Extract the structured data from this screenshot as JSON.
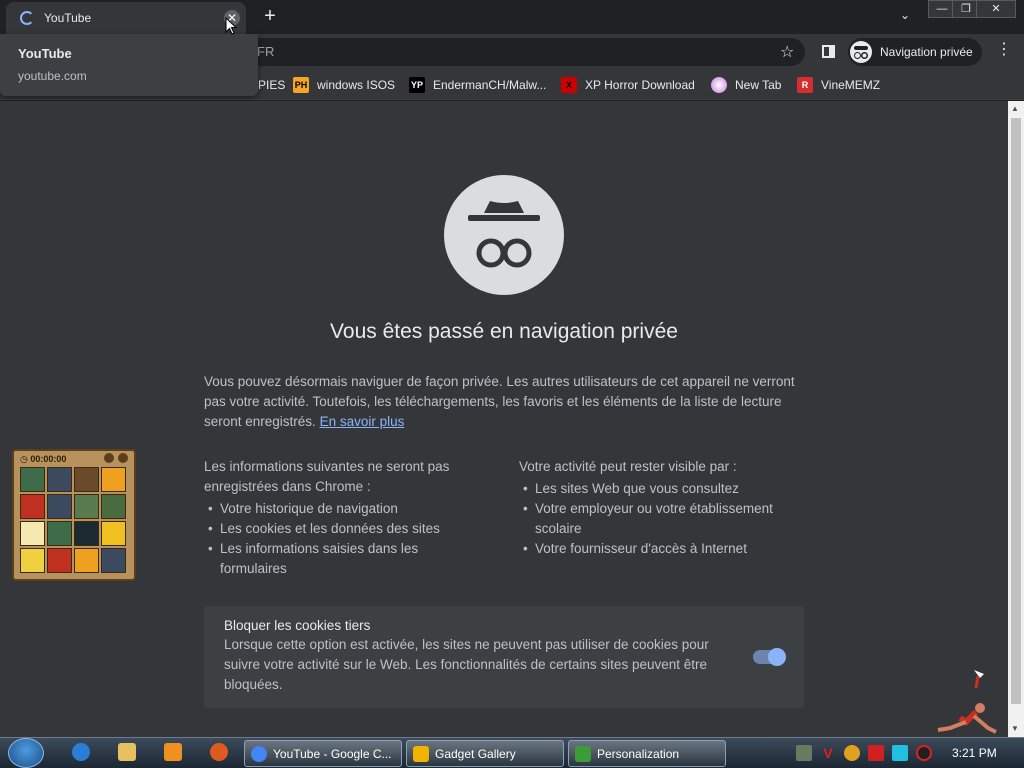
{
  "tab": {
    "title": "YouTube",
    "close_glyph": "✕"
  },
  "newtab_glyph": "+",
  "tabsearch_glyph": "⌄",
  "window_controls": {
    "minimize": "—",
    "restore": "❐",
    "close": "✕"
  },
  "omnibox": {
    "text": "FR"
  },
  "toolbar": {
    "star_glyph": "☆",
    "incognito_label": "Navigation privée",
    "menu_glyph": "⋮"
  },
  "hover_card": {
    "title": "YouTube",
    "url": "youtube.com"
  },
  "bookmarks": [
    {
      "label": "PIES",
      "icon": "bookmark-icon",
      "color": "#35363a"
    },
    {
      "label": "windows ISOS",
      "icon": "ph-icon",
      "badge": "PH",
      "color": "#f5a623"
    },
    {
      "label": "EndermanCH/Malw...",
      "icon": "yp-icon",
      "badge": "YP",
      "color": "#202124"
    },
    {
      "label": "XP Horror Download",
      "icon": "x-icon",
      "badge": "X",
      "color": "#cc0000"
    },
    {
      "label": "New Tab",
      "icon": "globe-icon",
      "badge": "",
      "color": "#c678dd"
    },
    {
      "label": "VineMEMZ",
      "icon": "r-icon",
      "badge": "R",
      "color": "#d32f2f"
    }
  ],
  "content": {
    "heading": "Vous êtes passé en navigation privée",
    "intro": "Vous pouvez désormais naviguer de façon privée. Les autres utilisateurs de cet appareil ne verront pas votre activité. Toutefois, les téléchargements, les favoris et les éléments de la liste de lecture seront enregistrés.",
    "learn_more": "En savoir plus",
    "left_title": "Les informations suivantes ne seront pas enregistrées dans Chrome :",
    "left_items": [
      "Votre historique de navigation",
      "Les cookies et les données des sites",
      "Les informations saisies dans les formulaires"
    ],
    "right_title": "Votre activité peut rester visible par :",
    "right_items": [
      "Les sites Web que vous consultez",
      "Votre employeur ou votre établissement scolaire",
      "Votre fournisseur d'accès à Internet"
    ],
    "cookie_title": "Bloquer les cookies tiers",
    "cookie_desc": "Lorsque cette option est activée, les sites ne peuvent pas utiliser de cookies pour suivre votre activité sur le Web. Les fonctionnalités de certains sites peuvent être bloquées.",
    "cookie_toggle_on": true
  },
  "puzzle_gadget": {
    "timer": "00:00:00"
  },
  "taskbar": {
    "buttons": [
      {
        "label": "YouTube - Google C...",
        "icon": "chrome-icon",
        "color": "#4285f4"
      },
      {
        "label": "Gadget Gallery",
        "icon": "gadget-icon",
        "color": "#f0b400"
      },
      {
        "label": "Personalization",
        "icon": "personalization-icon",
        "color": "#3a9d3a"
      }
    ],
    "clock": "3:21 PM"
  },
  "colors": {
    "accent": "#8ab4f8",
    "page_bg": "#35363a",
    "frame_bg": "#202124"
  }
}
